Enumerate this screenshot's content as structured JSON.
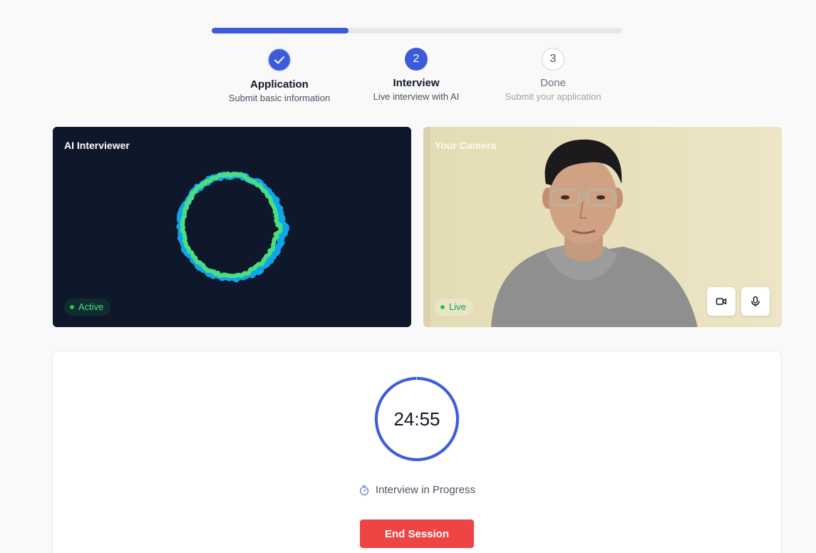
{
  "progress": {
    "fraction": 0.333
  },
  "steps": [
    {
      "number": "1",
      "title": "Application",
      "subtitle": "Submit basic information",
      "state": "completed"
    },
    {
      "number": "2",
      "title": "Interview",
      "subtitle": "Live interview with AI",
      "state": "current"
    },
    {
      "number": "3",
      "title": "Done",
      "subtitle": "Submit your application",
      "state": "upcoming"
    }
  ],
  "ai_panel": {
    "label": "AI Interviewer",
    "status": "Active"
  },
  "camera_panel": {
    "label": "Your Camera",
    "status": "Live",
    "video_icon": "video-camera-icon",
    "mic_icon": "microphone-icon"
  },
  "session": {
    "timer": "24:55",
    "timer_progress": 0.997,
    "status_icon": "stopwatch-icon",
    "status": "Interview in Progress",
    "end_button": "End Session"
  },
  "colors": {
    "accent": "#3b5bdb",
    "danger": "#ef4444",
    "live_green": "#22c55e",
    "wave_green": "#4ade80",
    "wave_blue": "#0ea5e9",
    "ai_panel_bg": "#0f172a"
  }
}
